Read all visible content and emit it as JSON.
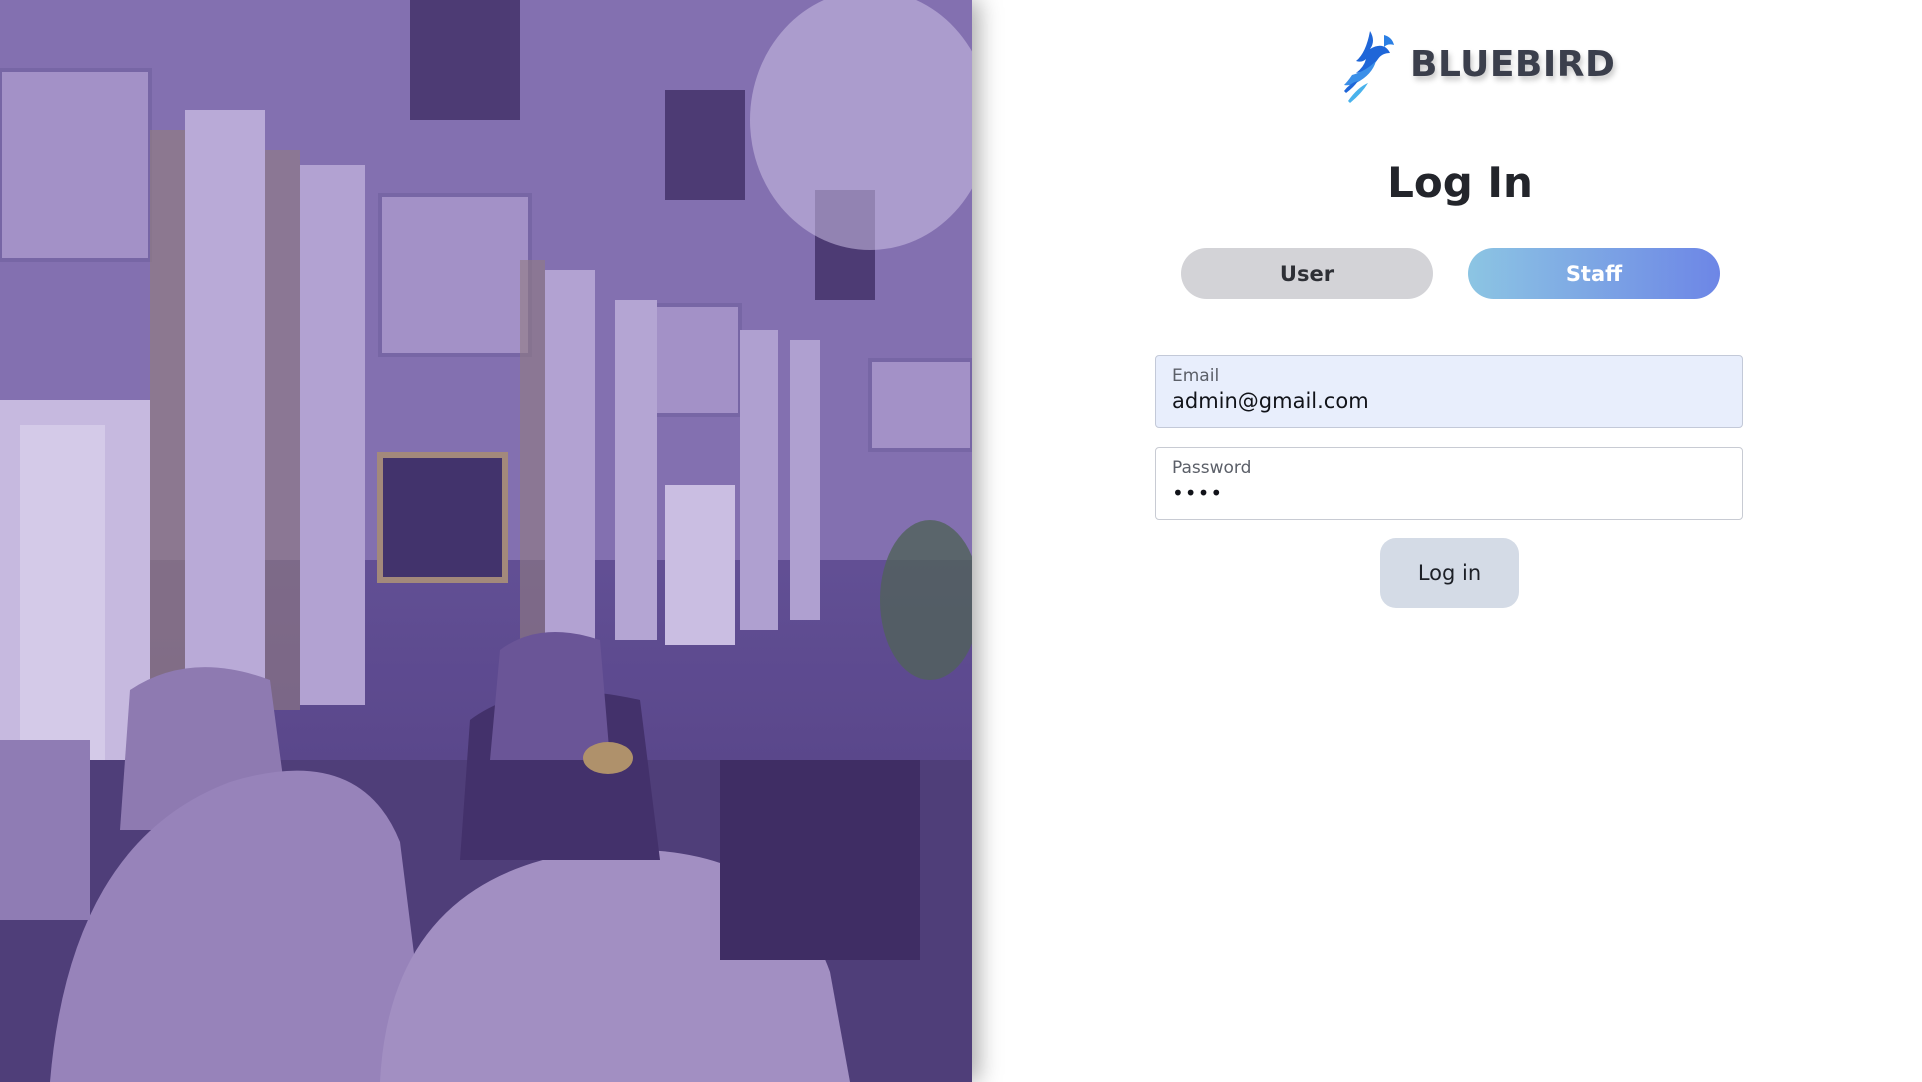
{
  "brand": {
    "name": "BLUEBIRD",
    "logo_icon": "bluebird-logo-icon",
    "colors": {
      "primary": "#1f66d8",
      "secondary": "#49b2ec"
    }
  },
  "page": {
    "title": "Log In"
  },
  "role_toggle": {
    "user_label": "User",
    "staff_label": "Staff",
    "selected": "Staff",
    "colors": {
      "active_start": "#8cc5e3",
      "active_end": "#6d86e6",
      "inactive": "#d3d3d7"
    }
  },
  "form": {
    "email": {
      "label": "Email",
      "value": "admin@gmail.com"
    },
    "password": {
      "label": "Password",
      "value": "••••"
    },
    "submit_label": "Log in"
  },
  "hero": {
    "image": "hotel-lobby-photo",
    "tint": "#6b5a9c"
  }
}
